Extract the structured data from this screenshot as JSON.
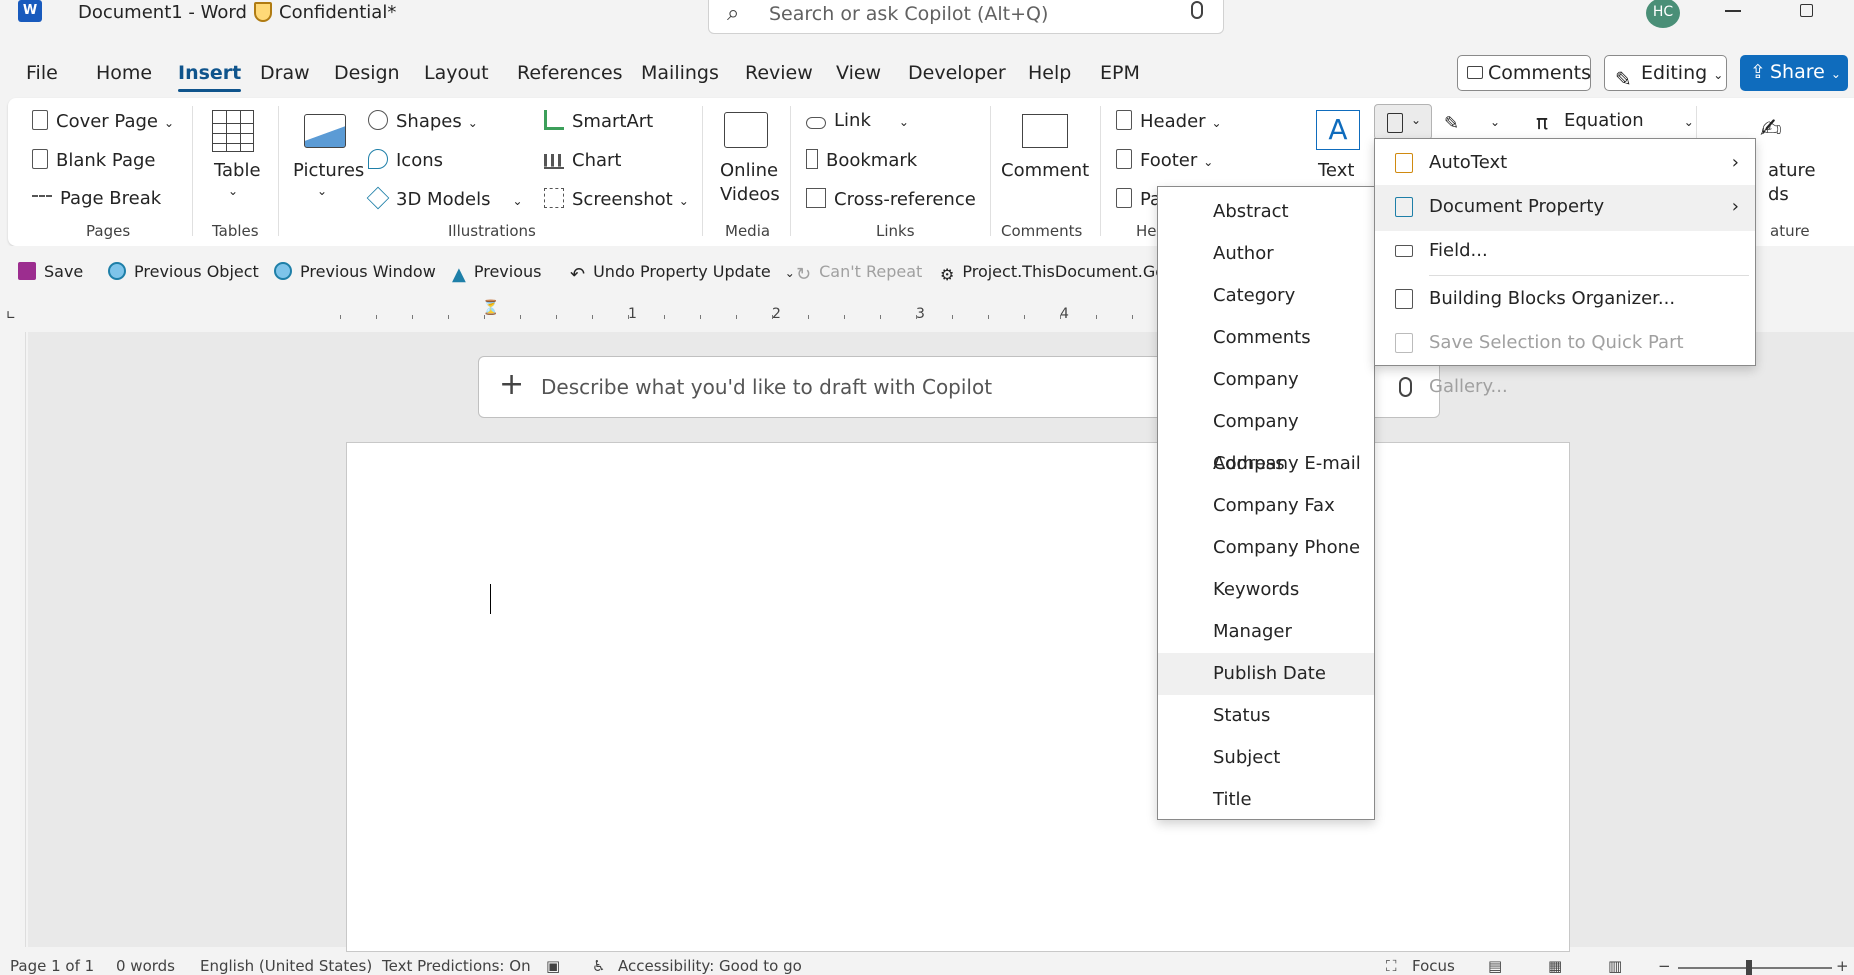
{
  "titlebar": {
    "app_logo": "W",
    "doc_title": "Document1  -  Word",
    "sensitivity": "Confidential*",
    "search_placeholder": "Search or ask Copilot (Alt+Q)",
    "avatar": "HC"
  },
  "tabs": [
    "File",
    "Home",
    "Insert",
    "Draw",
    "Design",
    "Layout",
    "References",
    "Mailings",
    "Review",
    "View",
    "Developer",
    "Help",
    "EPM"
  ],
  "active_tab": "Insert",
  "header_buttons": {
    "comments": "Comments",
    "editing": "Editing",
    "share": "Share"
  },
  "ribbon": {
    "pages": {
      "cover_page": "Cover Page",
      "blank_page": "Blank Page",
      "page_break": "Page Break",
      "label": "Pages"
    },
    "tables": {
      "table": "Table",
      "label": "Tables"
    },
    "illustrations": {
      "pictures": "Pictures",
      "shapes": "Shapes",
      "icons": "Icons",
      "models": "3D Models",
      "smartart": "SmartArt",
      "chart": "Chart",
      "screenshot": "Screenshot",
      "label": "Illustrations"
    },
    "media": {
      "online": "Online",
      "videos": "Videos",
      "label": "Media"
    },
    "links": {
      "link": "Link",
      "bookmark": "Bookmark",
      "cross_reference": "Cross-reference",
      "label": "Links"
    },
    "comments": {
      "comment": "Comment",
      "label": "Comments"
    },
    "header_footer": {
      "header": "Header",
      "footer": "Footer",
      "page_number": "Pa",
      "label": "He"
    },
    "text": {
      "text": "Text"
    },
    "symbols": {
      "equation": "Equation"
    },
    "signature": {
      "line1": "ature",
      "line2": "ds",
      "label": "ature"
    }
  },
  "qat": {
    "save": "Save",
    "previous_object": "Previous Object",
    "previous_window": "Previous Window",
    "previous": "Previous",
    "undo": "Undo Property Update",
    "cant_repeat": "Can't Repeat",
    "macro": "Project.ThisDocument.GoBa"
  },
  "ruler": {
    "numbers": [
      "1",
      "2",
      "3",
      "4"
    ]
  },
  "copilot_placeholder": "Describe what you'd like to draft with Copilot",
  "property_menu": {
    "items": [
      "Abstract",
      "Author",
      "Category",
      "Comments",
      "Company",
      "Company Address",
      "Company E-mail",
      "Company Fax",
      "Company Phone",
      "Keywords",
      "Manager",
      "Publish Date",
      "Status",
      "Subject",
      "Title"
    ],
    "hovered": "Publish Date"
  },
  "quickparts_menu": {
    "autotext": "AutoText",
    "document_property": "Document Property",
    "field": "Field...",
    "building_blocks": "Building Blocks Organizer...",
    "save_selection": "Save Selection to Quick Part Gallery..."
  },
  "status": {
    "page": "Page 1 of 1",
    "words": "0 words",
    "language": "English (United States)",
    "predictions": "Text Predictions: On",
    "accessibility": "Accessibility: Good to go",
    "focus": "Focus"
  },
  "colors": {
    "accent": "#0f6cbd",
    "active_tab": "#0f548c"
  }
}
